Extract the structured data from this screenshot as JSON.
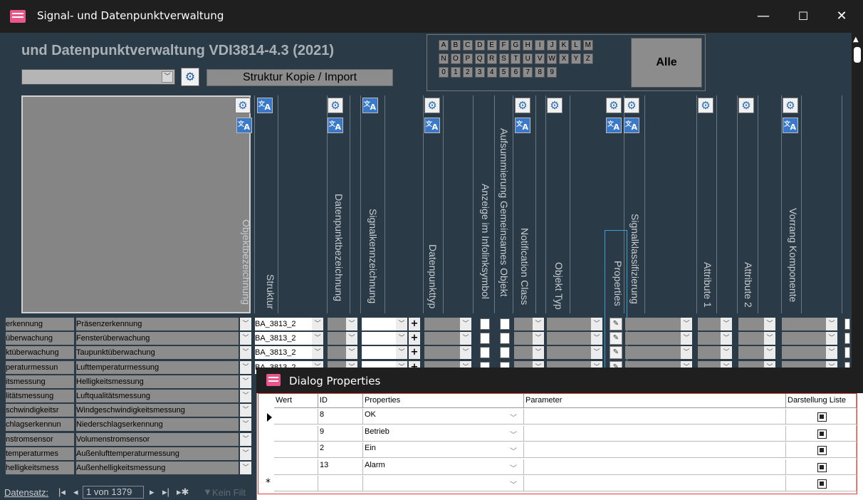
{
  "window": {
    "title": "Signal- und Datenpunktverwaltung",
    "min": "—",
    "max": "☐",
    "close": "✕"
  },
  "form": {
    "heading": "und Datenpunktverwaltung VDI3814-4.3 (2021)",
    "struktur_button": "Struktur Kopie / Import",
    "alle_button": "Alle",
    "alpha_rows": [
      [
        "A",
        "B",
        "C",
        "D",
        "E",
        "F",
        "G",
        "H",
        "I",
        "J",
        "K",
        "L",
        "M"
      ],
      [
        "N",
        "O",
        "P",
        "Q",
        "R",
        "S",
        "T",
        "U",
        "V",
        "W",
        "X",
        "Y",
        "Z"
      ],
      [
        "0",
        "1",
        "2",
        "3",
        "4",
        "5",
        "6",
        "7",
        "8",
        "9"
      ]
    ]
  },
  "columns": {
    "objekt": "Objektbezeichnung",
    "struktur": "Struktur",
    "dp_bez": "Datenpunktbezeichnung",
    "signal_kenn": "Signalkennzeichnung",
    "dp_typ": "Datenpunkttyp",
    "anzeige": "Anzeige im Infolinksymbol",
    "aufsumm": "Aufsummierung Gemeinsames Objekt",
    "notif": "Notification Class",
    "objtyp": "Objekt Typ",
    "props": "Properties",
    "sigklass": "Signalklassifizierung",
    "attr1": "Attribute 1",
    "attr2": "Attribute 2",
    "vorrang": "Vorrang Komponente"
  },
  "rows": [
    {
      "a": "erkennung",
      "b": "Präsenzerkennung",
      "s": "BA_3813_2"
    },
    {
      "a": "überwachung",
      "b": "Fensterüberwachung",
      "s": "BA_3813_2"
    },
    {
      "a": "ktüberwachung",
      "b": "Taupunktüberwachung",
      "s": "BA_3813_2"
    },
    {
      "a": "peraturmessun",
      "b": "Lufttemperaturmessung",
      "s": "BA_3813_2"
    },
    {
      "a": "itsmessung",
      "b": "Helligkeitsmessung",
      "s": ""
    },
    {
      "a": "litätsmessung",
      "b": "Luftqualitätsmessung",
      "s": ""
    },
    {
      "a": "schwindigkeitsr",
      "b": "Windgeschwindigkeitsmessung",
      "s": ""
    },
    {
      "a": "chlagserkennun",
      "b": "Niederschlagserkennung",
      "s": ""
    },
    {
      "a": "nstromsensor",
      "b": "Volumenstromsensor",
      "s": ""
    },
    {
      "a": "temperaturmes",
      "b": "Außenlufttemperaturmessung",
      "s": ""
    },
    {
      "a": "helligkeitsmess",
      "b": "Außenhelligkeitsmessung",
      "s": ""
    }
  ],
  "nav": {
    "label": "Datensatz:",
    "record": "1 von 1379",
    "filter": "Kein Filt"
  },
  "dialog": {
    "title": "Dialog Properties",
    "headers": {
      "wert": "Wert",
      "id": "ID",
      "properties": "Properties",
      "parameter": "Parameter",
      "darstellung": "Darstellung Liste"
    },
    "rows": [
      {
        "id": "8",
        "prop": "OK"
      },
      {
        "id": "9",
        "prop": "Betrieb"
      },
      {
        "id": "2",
        "prop": "Ein"
      },
      {
        "id": "13",
        "prop": "Alarm"
      }
    ],
    "new_row_marker": "*"
  }
}
